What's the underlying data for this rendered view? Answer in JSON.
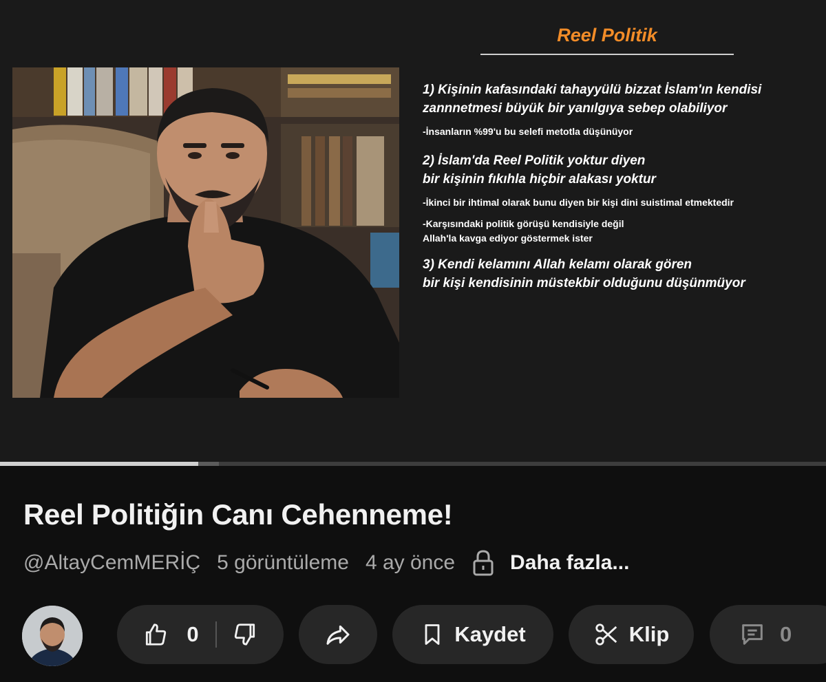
{
  "slide": {
    "title": "Reel Politik",
    "points": [
      {
        "line1": "1) Kişinin kafasındaki tahayyülü bizzat İslam'ın kendisi",
        "line2": " zannnetmesi büyük bir yanılgıya sebep olabiliyor"
      },
      {
        "line1": "2) İslam'da Reel Politik yoktur diyen",
        "line2": " bir kişinin fıkıhla hiçbir alakası yoktur"
      },
      {
        "line1": "3) Kendi kelamını Allah kelamı olarak gören",
        "line2": "bir kişi kendisinin müstekbir olduğunu düşünmüyor"
      }
    ],
    "notes": [
      "-İnsanların %99'u bu selefi metotla düşünüyor",
      "-İkinci bir ihtimal olarak bunu diyen bir kişi dini suistimal etmektedir",
      "-Karşısındaki politik görüşü kendisiyle değil",
      "Allah'la kavga ediyor göstermek ister"
    ]
  },
  "player": {
    "progress_played": 0.24,
    "progress_buffered": 0.265
  },
  "video": {
    "title": "Reel Politiğin Canı Cehenneme!",
    "channel": "@AltayCemMERİÇ",
    "views": "5 görüntüleme",
    "age": "4 ay önce",
    "more": "Daha fazla..."
  },
  "actions": {
    "like_count": "0",
    "save_label": "Kaydet",
    "clip_label": "Klip",
    "comment_count": "0"
  },
  "icons": {
    "visibility": "lock-icon",
    "like": "thumbs-up-icon",
    "dislike": "thumbs-down-icon",
    "share": "share-arrow-icon",
    "save": "bookmark-icon",
    "clip": "scissors-icon",
    "comments": "comment-icon"
  },
  "colors": {
    "background": "#0f0f0f",
    "slide_background": "#1a1a1a",
    "slide_title": "#f28c28",
    "pill": "#272727",
    "muted_text": "#aaaaaa"
  }
}
